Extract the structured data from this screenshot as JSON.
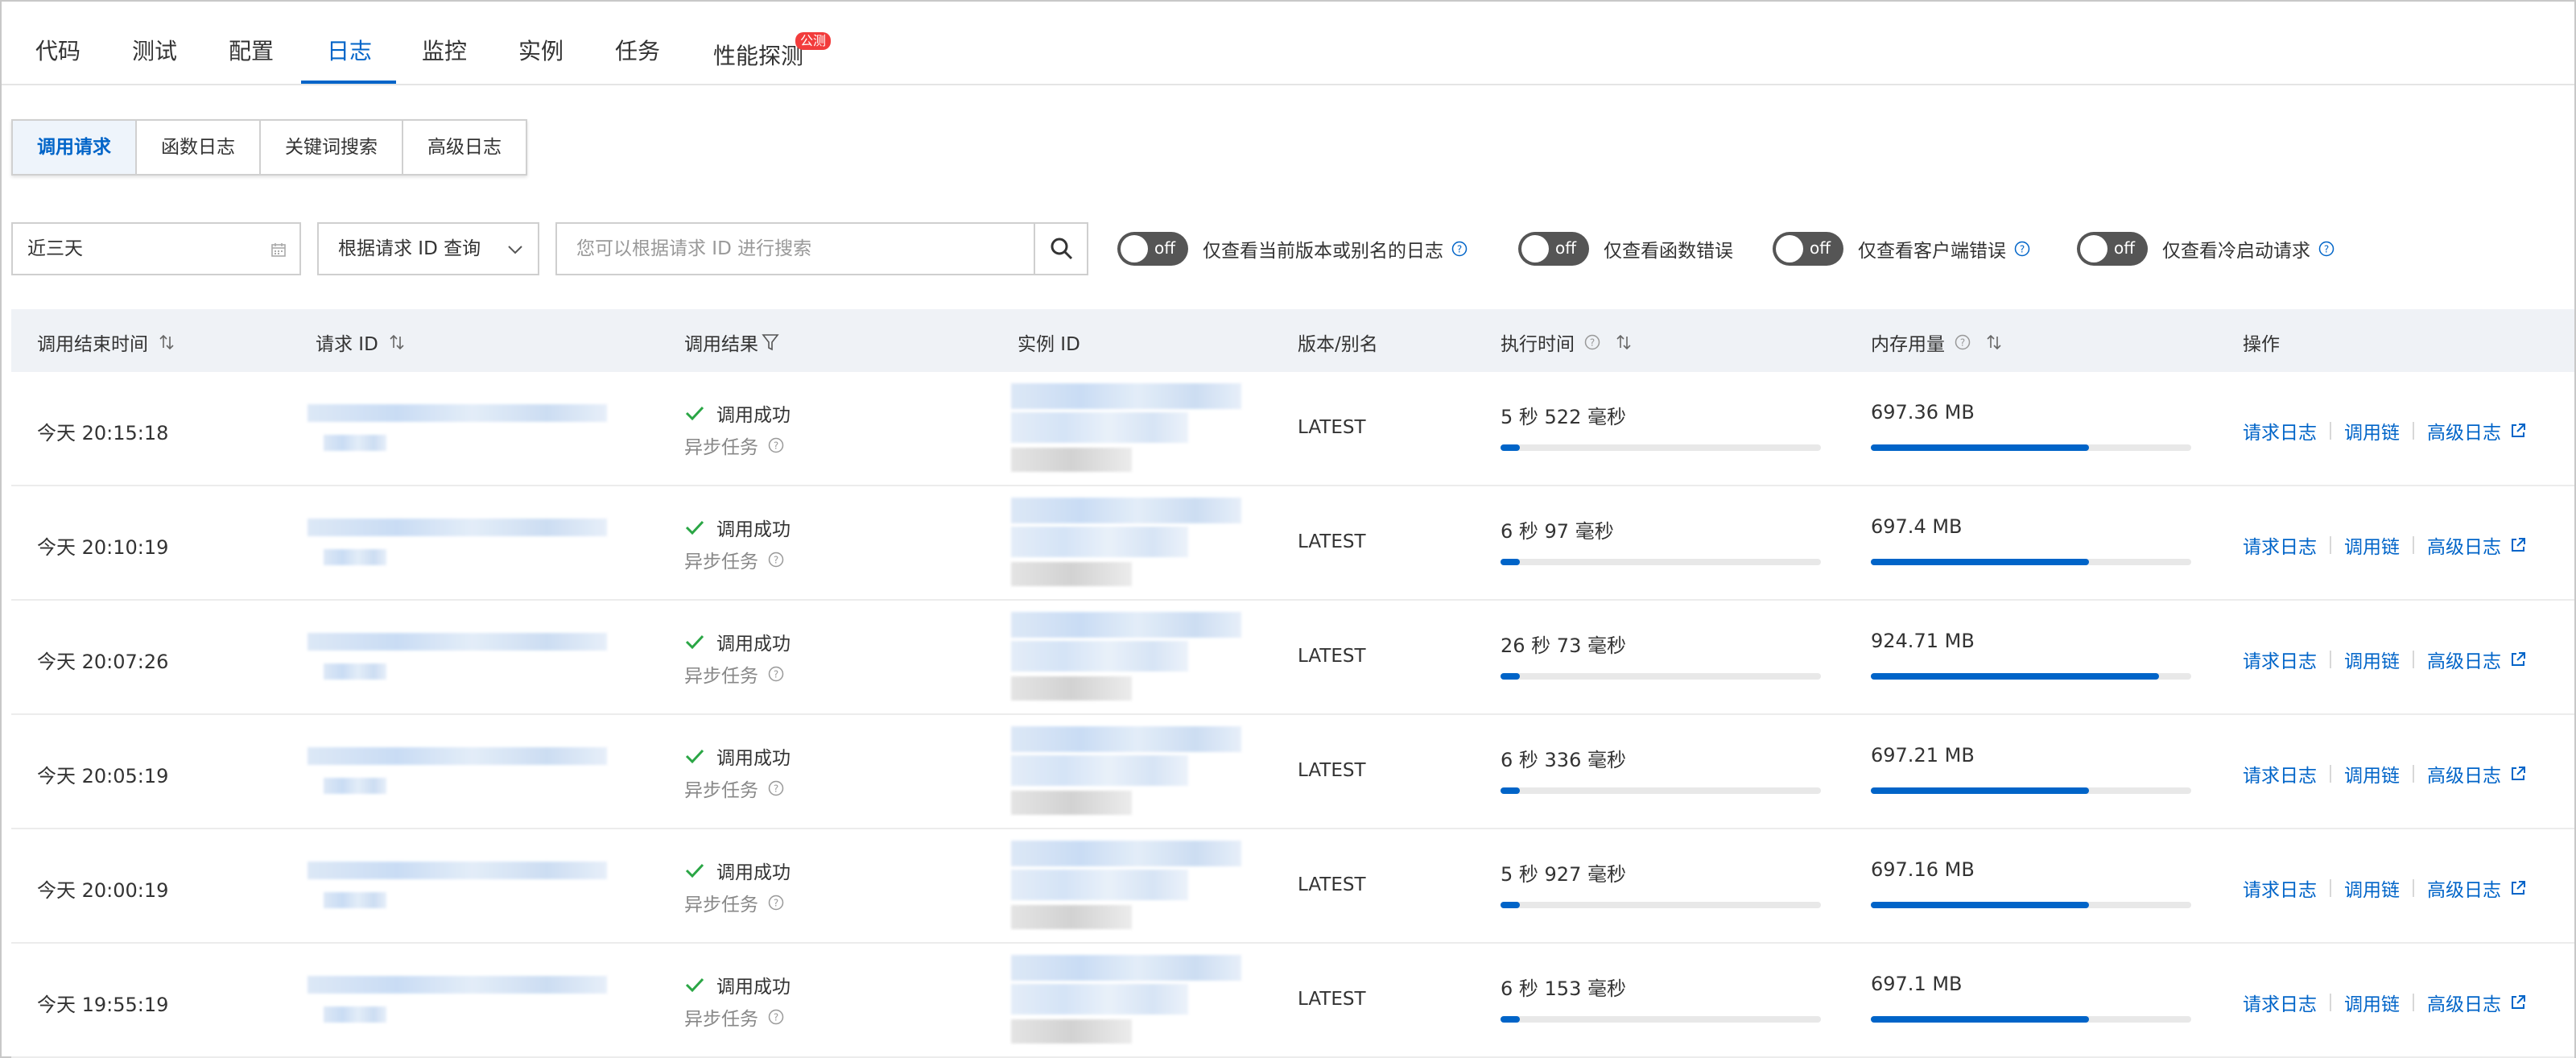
{
  "nav": {
    "tabs": [
      "代码",
      "测试",
      "配置",
      "日志",
      "监控",
      "实例",
      "任务",
      "性能探测"
    ],
    "active": "日志",
    "beta_badge": "公测"
  },
  "subtabs": {
    "items": [
      "调用请求",
      "函数日志",
      "关键词搜索",
      "高级日志"
    ],
    "active": "调用请求"
  },
  "filters": {
    "date_range": "近三天",
    "query_type": "根据请求 ID 查询",
    "search_placeholder": "您可以根据请求 ID 进行搜索",
    "toggles": [
      {
        "label": "仅查看当前版本或别名的日志",
        "state": "off",
        "help": true
      },
      {
        "label": "仅查看函数错误",
        "state": "off",
        "help": false
      },
      {
        "label": "仅查看客户端错误",
        "state": "off",
        "help": true
      },
      {
        "label": "仅查看冷启动请求",
        "state": "off",
        "help": true
      }
    ]
  },
  "table": {
    "headers": {
      "end_time": "调用结束时间",
      "request_id": "请求 ID",
      "result": "调用结果",
      "instance_id": "实例 ID",
      "version": "版本/别名",
      "exec_time": "执行时间",
      "memory": "内存用量",
      "actions": "操作"
    },
    "rows": [
      {
        "time": "今天 20:15:18",
        "result": "调用成功",
        "sub": "异步任务",
        "version": "LATEST",
        "exec": "5 秒 522 毫秒",
        "exec_fraction": 0.01,
        "mem": "697.36 MB",
        "mem_fraction": 0.68
      },
      {
        "time": "今天 20:10:19",
        "result": "调用成功",
        "sub": "异步任务",
        "version": "LATEST",
        "exec": "6 秒 97 毫秒",
        "exec_fraction": 0.01,
        "mem": "697.4 MB",
        "mem_fraction": 0.68
      },
      {
        "time": "今天 20:07:26",
        "result": "调用成功",
        "sub": "异步任务",
        "version": "LATEST",
        "exec": "26 秒 73 毫秒",
        "exec_fraction": 0.04,
        "mem": "924.71 MB",
        "mem_fraction": 0.9
      },
      {
        "time": "今天 20:05:19",
        "result": "调用成功",
        "sub": "异步任务",
        "version": "LATEST",
        "exec": "6 秒 336 毫秒",
        "exec_fraction": 0.01,
        "mem": "697.21 MB",
        "mem_fraction": 0.68
      },
      {
        "time": "今天 20:00:19",
        "result": "调用成功",
        "sub": "异步任务",
        "version": "LATEST",
        "exec": "5 秒 927 毫秒",
        "exec_fraction": 0.01,
        "mem": "697.16 MB",
        "mem_fraction": 0.68
      },
      {
        "time": "今天 19:55:19",
        "result": "调用成功",
        "sub": "异步任务",
        "version": "LATEST",
        "exec": "6 秒 153 毫秒",
        "exec_fraction": 0.01,
        "mem": "697.1 MB",
        "mem_fraction": 0.68
      }
    ],
    "actions": [
      "请求日志",
      "调用链",
      "高级日志"
    ]
  },
  "colors": {
    "accent": "#0064c8",
    "badge": "#f23c3c",
    "switch_off": "#555555",
    "header_bg": "#eff2f6"
  },
  "icons": [
    "calendar-icon",
    "chevron-down-icon",
    "search-icon",
    "help-icon",
    "sort-icon",
    "filter-icon",
    "check-icon",
    "external-link-icon"
  ]
}
